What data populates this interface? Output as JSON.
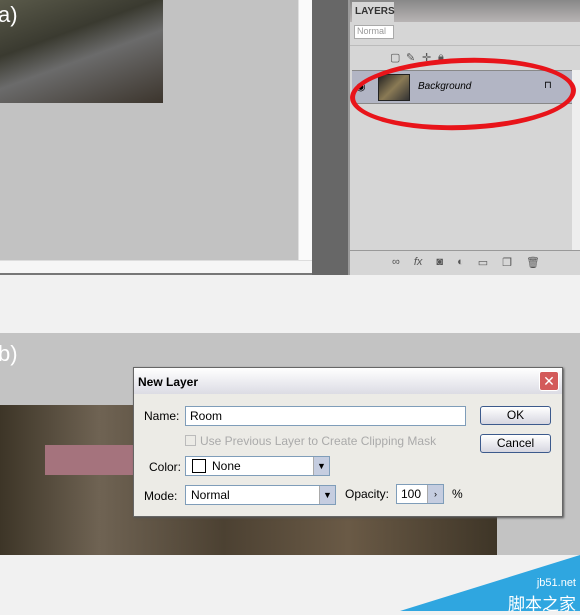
{
  "panel_a": {
    "label": "a)"
  },
  "layers_panel": {
    "tab": "LAYERS",
    "blend_mode": "Normal",
    "layer": {
      "name": "Background"
    },
    "footer_icons": [
      "link-icon",
      "fx-icon",
      "mask-icon",
      "adjustment-icon",
      "group-icon",
      "new-layer-icon",
      "trash-icon"
    ]
  },
  "panel_b": {
    "label": "b)"
  },
  "dialog": {
    "title": "New Layer",
    "name_label": "Name:",
    "name_value": "Room",
    "clip_label": "Use Previous Layer to Create Clipping Mask",
    "color_label": "Color:",
    "color_value": "None",
    "mode_label": "Mode:",
    "mode_value": "Normal",
    "opacity_label": "Opacity:",
    "opacity_value": "100",
    "opacity_unit": "%",
    "ok": "OK",
    "cancel": "Cancel"
  },
  "watermark": {
    "line1": "jb51.net",
    "line2": "脚本之家"
  },
  "colors": {
    "highlight": "#e8141a",
    "watermark": "#2fa6e0"
  }
}
